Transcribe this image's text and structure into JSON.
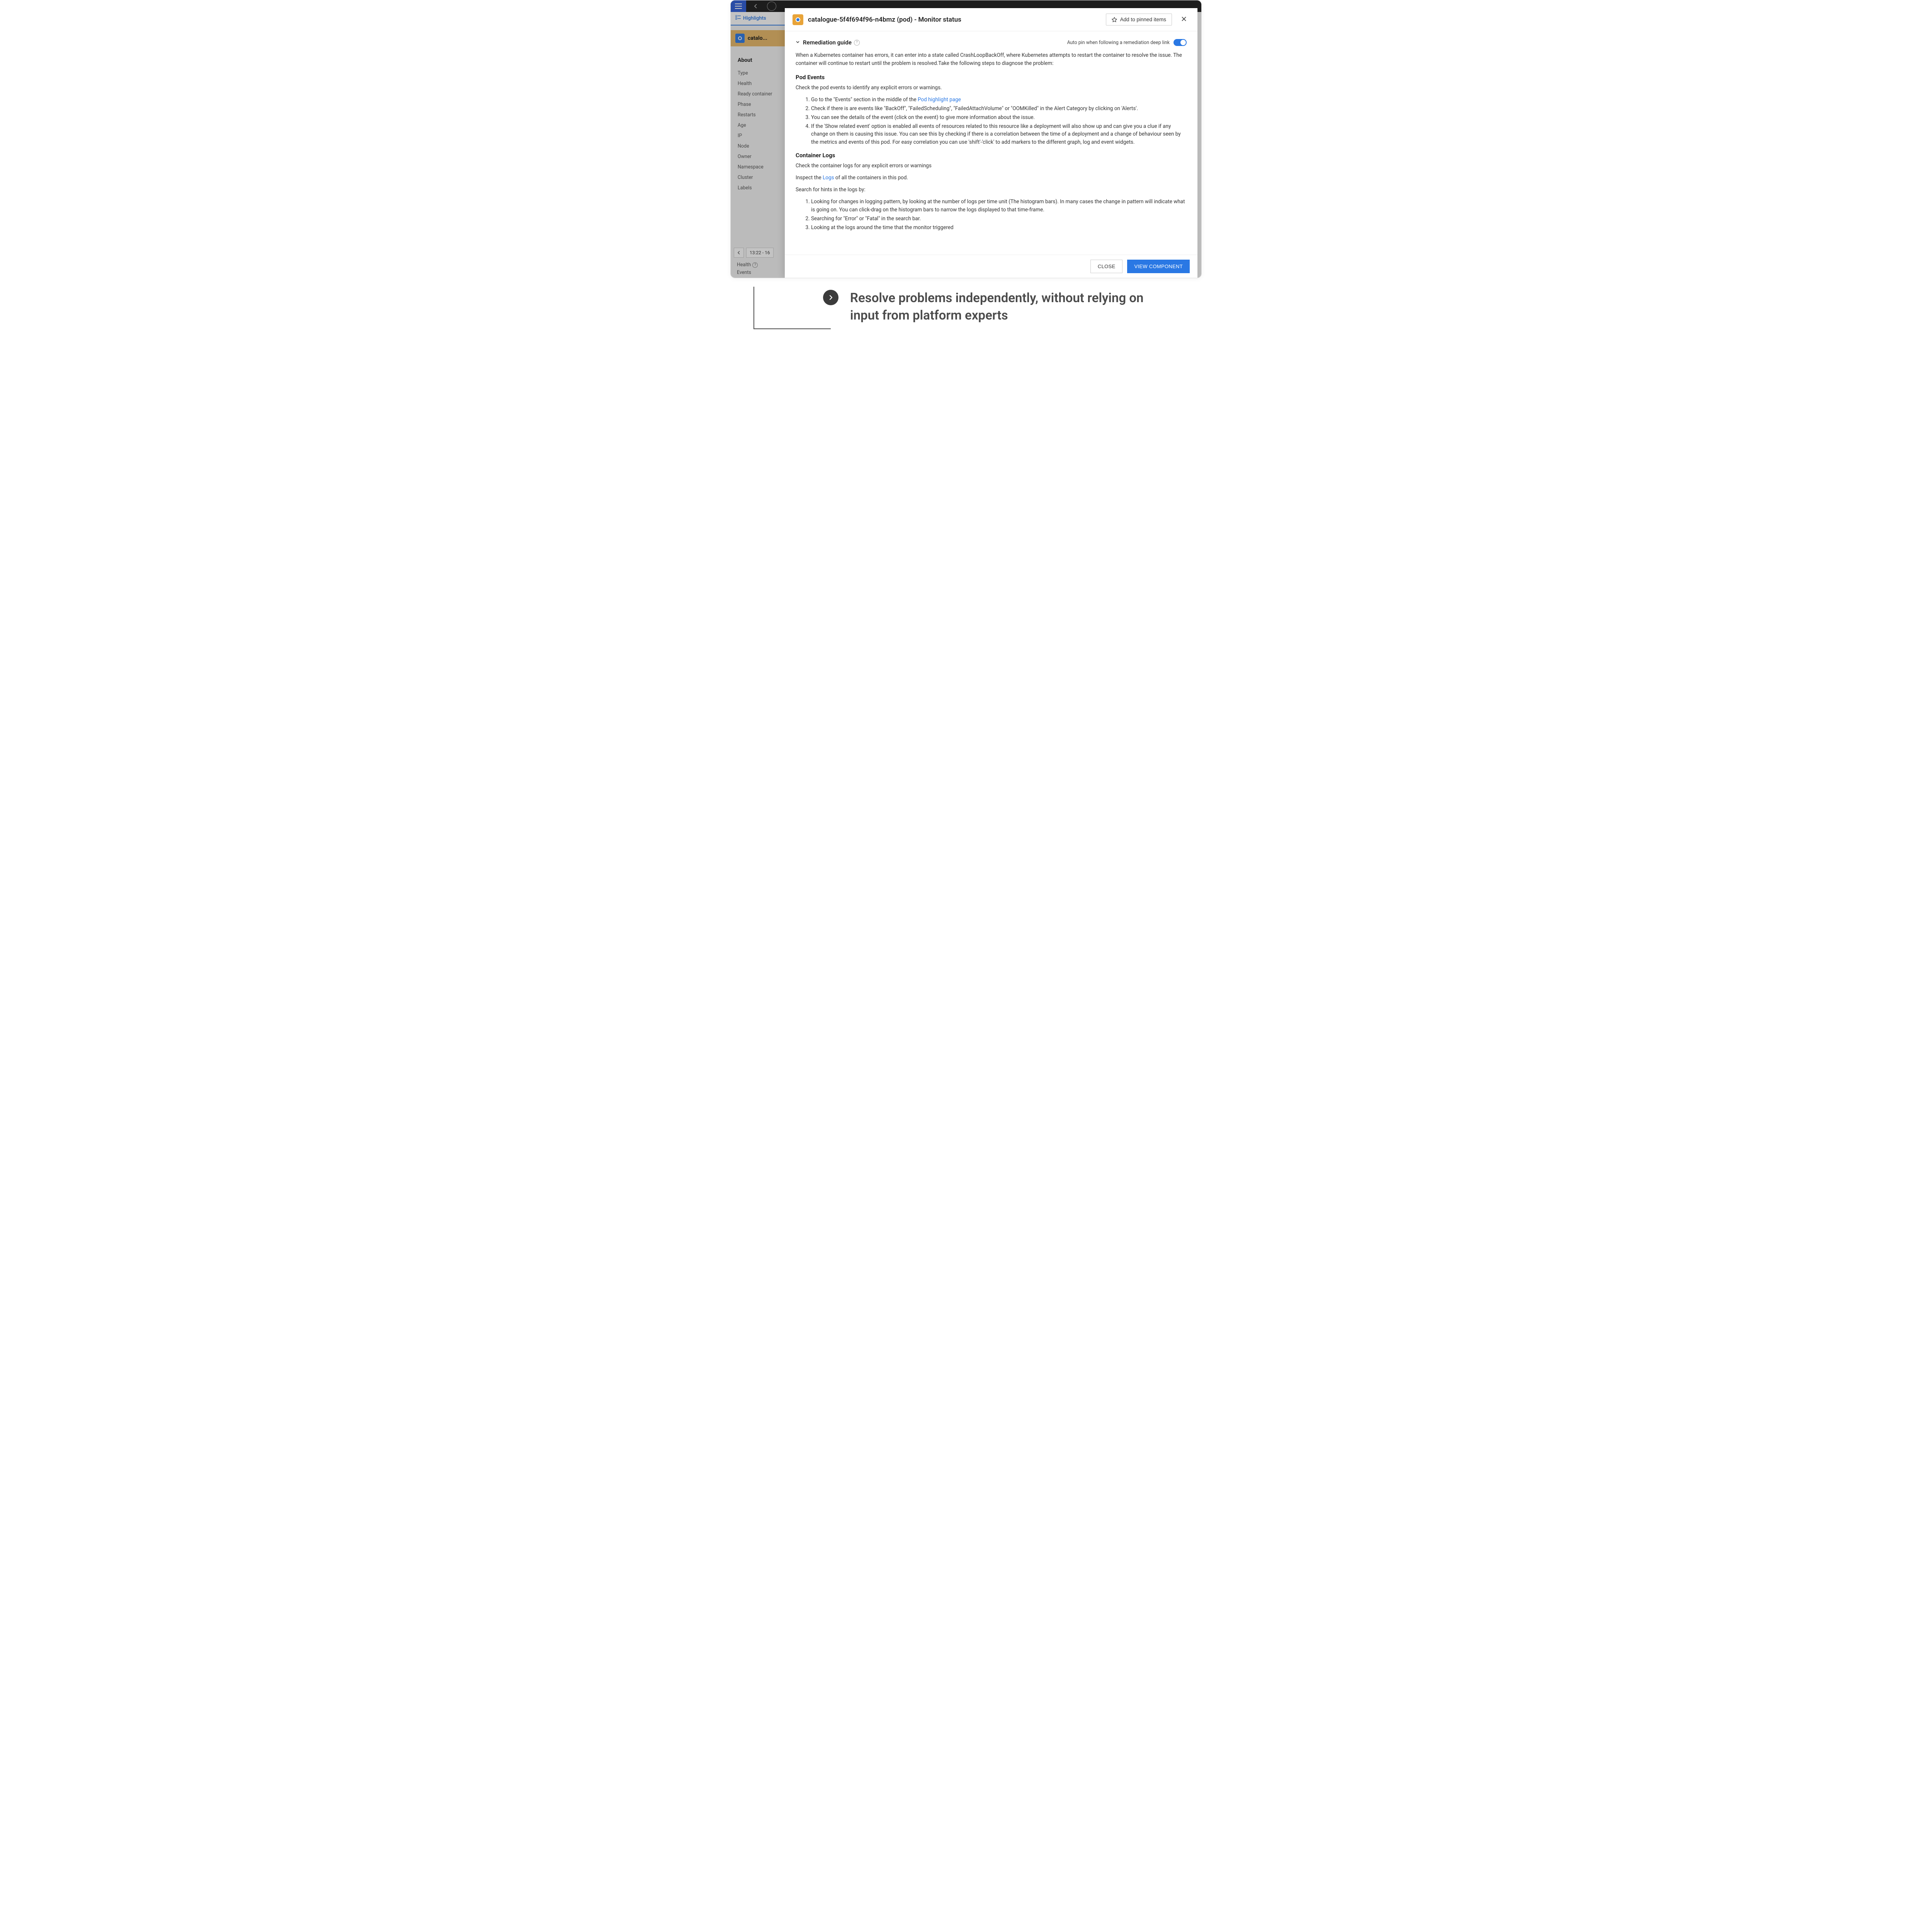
{
  "topbar": {},
  "tabs": {
    "highlights": "Highlights"
  },
  "sidebar": {
    "catalo_label": "catalo...",
    "about_heading": "About",
    "items": [
      "Type",
      "Health",
      "Ready container",
      "Phase",
      "Restarts",
      "Age",
      "IP",
      "Node",
      "Owner",
      "Namespace",
      "Cluster",
      "Labels"
    ],
    "time_display": "13:22 - 16",
    "health_label": "Health",
    "events_label": "Events"
  },
  "modal": {
    "title": "catalogue-5f4f694f96-n4bmz (pod) - Monitor status",
    "pin_button": "Add to pinned items",
    "guide_title": "Remediation guide",
    "autopin_label": "Auto pin when following a remediation deep link",
    "intro": "When a Kubernetes container has errors, it can enter into a state called CrashLoopBackOff, where Kubernetes attempts to restart the container to resolve the issue. The container will continue to restart until the problem is resolved.Take the following steps to diagnose the problem:",
    "pod_events_h": "Pod Events",
    "pod_events_p": "Check the pod events to identify any explicit errors or warnings.",
    "pod_steps": {
      "s1_pre": "Go to the \"Events\" section in the middle of the ",
      "s1_link": "Pod highlight page",
      "s2": "Check if there is are events like \"BackOff\", \"FailedScheduling\", \"FailedAttachVolume\" or \"OOMKilled\" in the Alert Category by clicking on 'Alerts'.",
      "s3": "You can see the details of the event (click on the event) to give more information about the issue.",
      "s4": "If the 'Show related event' option is enabled all events of resources related to this resource like a deployment will also show up and can give you a clue if any change on them is causing this issue. You can see this by checking if there is a correlation between the time of a deployment and a change of behaviour seen by the metrics and events of this pod. For easy correlation you can use 'shift'-'click' to add markers to the different graph, log and event widgets."
    },
    "logs_h": "Container Logs",
    "logs_p1": "Check the container logs for any explicit errors or warnings",
    "logs_p2_pre": "Inspect the ",
    "logs_p2_link": "Logs",
    "logs_p2_post": " of all the containers in this pod.",
    "logs_p3": "Search for hints in the logs by:",
    "logs_steps": {
      "s1": "Looking for changes in logging pattern, by looking at the number of logs per time unit (The histogram bars). In many cases the change in pattern will indicate what is going on. You can click-drag on the histogram bars to narrow the logs displayed to that time-frame.",
      "s2": "Searching for \"Error\" or \"Fatal\" in the search bar.",
      "s3": "Looking at the logs around the time that the monitor triggered"
    },
    "close_btn": "CLOSE",
    "view_btn": "VIEW COMPONENT"
  },
  "callout": {
    "text": "Resolve problems independently, without relying on input from platform experts"
  }
}
